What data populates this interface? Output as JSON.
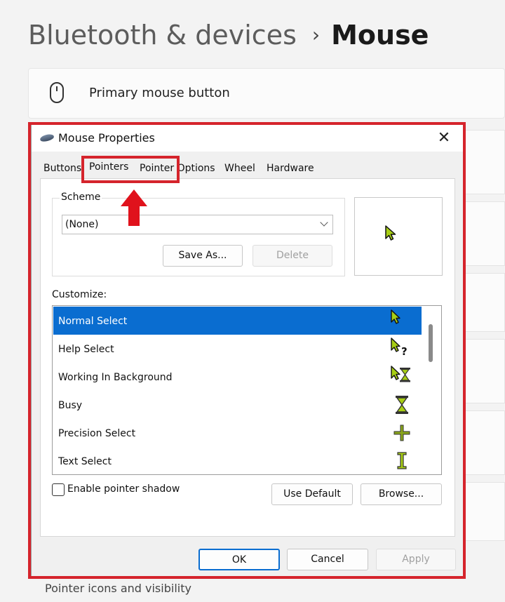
{
  "settings": {
    "breadcrumb_parent": "Bluetooth & devices",
    "breadcrumb_separator": "›",
    "breadcrumb_current": "Mouse",
    "primary_mouse_button_label": "Primary mouse button",
    "bottom_item_label": "Pointer icons and visibility"
  },
  "dialog": {
    "title": "Mouse Properties",
    "close_glyph": "✕",
    "tabs": [
      {
        "label": "Buttons"
      },
      {
        "label": "Pointers"
      },
      {
        "label": "Pointer Options"
      },
      {
        "label": "Wheel"
      },
      {
        "label": "Hardware"
      }
    ],
    "active_tab": "Pointers",
    "scheme": {
      "label": "Scheme",
      "selected": "(None)",
      "save_as_label": "Save As...",
      "delete_label": "Delete"
    },
    "customize_label": "Customize:",
    "cursors": [
      {
        "label": "Normal Select",
        "icon": "normal-select-icon",
        "selected": true
      },
      {
        "label": "Help Select",
        "icon": "help-select-icon"
      },
      {
        "label": "Working In Background",
        "icon": "working-in-background-icon"
      },
      {
        "label": "Busy",
        "icon": "busy-icon"
      },
      {
        "label": "Precision Select",
        "icon": "precision-select-icon"
      },
      {
        "label": "Text Select",
        "icon": "text-select-icon"
      }
    ],
    "enable_shadow_label": "Enable pointer shadow",
    "enable_shadow_checked": false,
    "use_default_label": "Use Default",
    "browse_label": "Browse...",
    "ok_label": "OK",
    "cancel_label": "Cancel",
    "apply_label": "Apply"
  },
  "colors": {
    "annotation_red": "#d5242c",
    "selection_blue": "#0a6dd0",
    "cursor_green": "#a8cf14"
  }
}
